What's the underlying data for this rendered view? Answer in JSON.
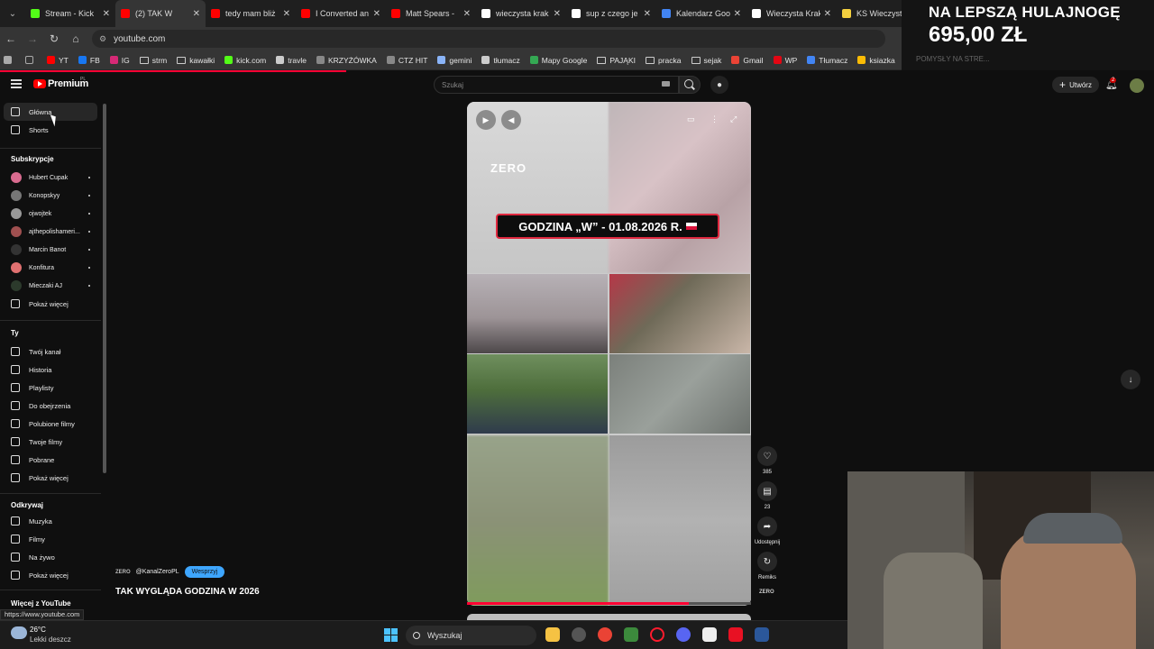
{
  "browser": {
    "tabs": [
      {
        "title": "Stream - Kick",
        "color": "#53fc18",
        "active": false
      },
      {
        "title": "(2) TAK W",
        "color": "#ff0000",
        "active": true
      },
      {
        "title": "tedy mam bliż",
        "color": "#ff0000",
        "active": false
      },
      {
        "title": "I Converted an",
        "color": "#ff0000",
        "active": false
      },
      {
        "title": "Matt Spears -",
        "color": "#ff0000",
        "active": false
      },
      {
        "title": "wieczysta krak",
        "color": "#ffffff",
        "active": false
      },
      {
        "title": "sup z czego je",
        "color": "#ffffff",
        "active": false
      },
      {
        "title": "Kalendarz Goo",
        "color": "#4285f4",
        "active": false
      },
      {
        "title": "Wieczysta Krak",
        "color": "#ffffff",
        "active": false
      },
      {
        "title": "KS Wieczysta",
        "color": "#f4d03f",
        "active": false
      }
    ],
    "url": "youtube.com",
    "bookmarks": [
      {
        "label": "YT",
        "color": "#ff0000"
      },
      {
        "label": "FB",
        "color": "#1877f2"
      },
      {
        "label": "IG",
        "color": "#d62976"
      },
      {
        "label": "strm",
        "color": "folder"
      },
      {
        "label": "kawałki",
        "color": "folder"
      },
      {
        "label": "kick.com",
        "color": "#53fc18"
      },
      {
        "label": "travle",
        "color": "#cccccc"
      },
      {
        "label": "KRZYŻÓWKA",
        "color": "#888888"
      },
      {
        "label": "CTZ HIT",
        "color": "#888888"
      },
      {
        "label": "gemini",
        "color": "#8ab4f8"
      },
      {
        "label": "tłumacz",
        "color": "#cccccc"
      },
      {
        "label": "Mapy Google",
        "color": "#34a853"
      },
      {
        "label": "PAJĄKI",
        "color": "folder"
      },
      {
        "label": "pracka",
        "color": "folder"
      },
      {
        "label": "sejak",
        "color": "folder"
      },
      {
        "label": "Gmail",
        "color": "#ea4335"
      },
      {
        "label": "WP",
        "color": "#e30613"
      },
      {
        "label": "Tłumacz",
        "color": "#4285f4"
      },
      {
        "label": "ksiazka",
        "color": "#fbbc05"
      }
    ]
  },
  "promo": {
    "line1": "NA LEPSZĄ HULAJNOGĘ",
    "line2": "695,00 ZŁ",
    "sub": "POMYSŁY NA STRE..."
  },
  "youtube": {
    "brand": "Premium",
    "region": "PL",
    "search_placeholder": "Szukaj",
    "create_label": "Utwórz",
    "notifications_count": "2",
    "sidebar": {
      "nav": [
        {
          "label": "Główna"
        },
        {
          "label": "Shorts"
        }
      ],
      "subs_title": "Subskrypcje",
      "subs": [
        {
          "label": "Hubert Cupak",
          "color": "#d96b8f"
        },
        {
          "label": "Konopskyy",
          "color": "#777777"
        },
        {
          "label": "ojwojtek",
          "color": "#999999"
        },
        {
          "label": "ajthepolishameri...",
          "color": "#a05050"
        },
        {
          "label": "Marcin Banot",
          "color": "#333333"
        },
        {
          "label": "Konfitura",
          "color": "#e07070"
        },
        {
          "label": "Mieczaki AJ",
          "color": "#2c3a2c"
        }
      ],
      "show_more": "Pokaż więcej",
      "you_title": "Ty",
      "you_items": [
        {
          "label": "Twój kanał"
        },
        {
          "label": "Historia"
        },
        {
          "label": "Playlisty"
        },
        {
          "label": "Do obejrzenia"
        },
        {
          "label": "Polubione filmy"
        },
        {
          "label": "Twoje filmy"
        },
        {
          "label": "Pobrane"
        },
        {
          "label": "Pokaż więcej"
        }
      ],
      "explore_title": "Odkrywaj",
      "explore_items": [
        {
          "label": "Muzyka"
        },
        {
          "label": "Filmy"
        },
        {
          "label": "Na żywo"
        },
        {
          "label": "Pokaż więcej"
        }
      ],
      "more_title": "Więcej z YouTube"
    },
    "short": {
      "banner": "GODZINA „W” - 01.08.2026 R.",
      "watermark": "ZERO",
      "channel_logo": "ZERO",
      "channel": "@KanalZeroPL",
      "support": "Wesprzyj",
      "title": "TAK WYGLĄDA GODZINA W 2026",
      "progress": 0.78,
      "likes": "385",
      "comments": "23",
      "share": "Udostępnij",
      "remix": "Remiks",
      "rail_logo": "ZERO"
    }
  },
  "statusbar_url": "https://www.youtube.com",
  "taskbar": {
    "temp": "26°C",
    "weather": "Lekki deszcz",
    "search": "Wyszukaj"
  }
}
